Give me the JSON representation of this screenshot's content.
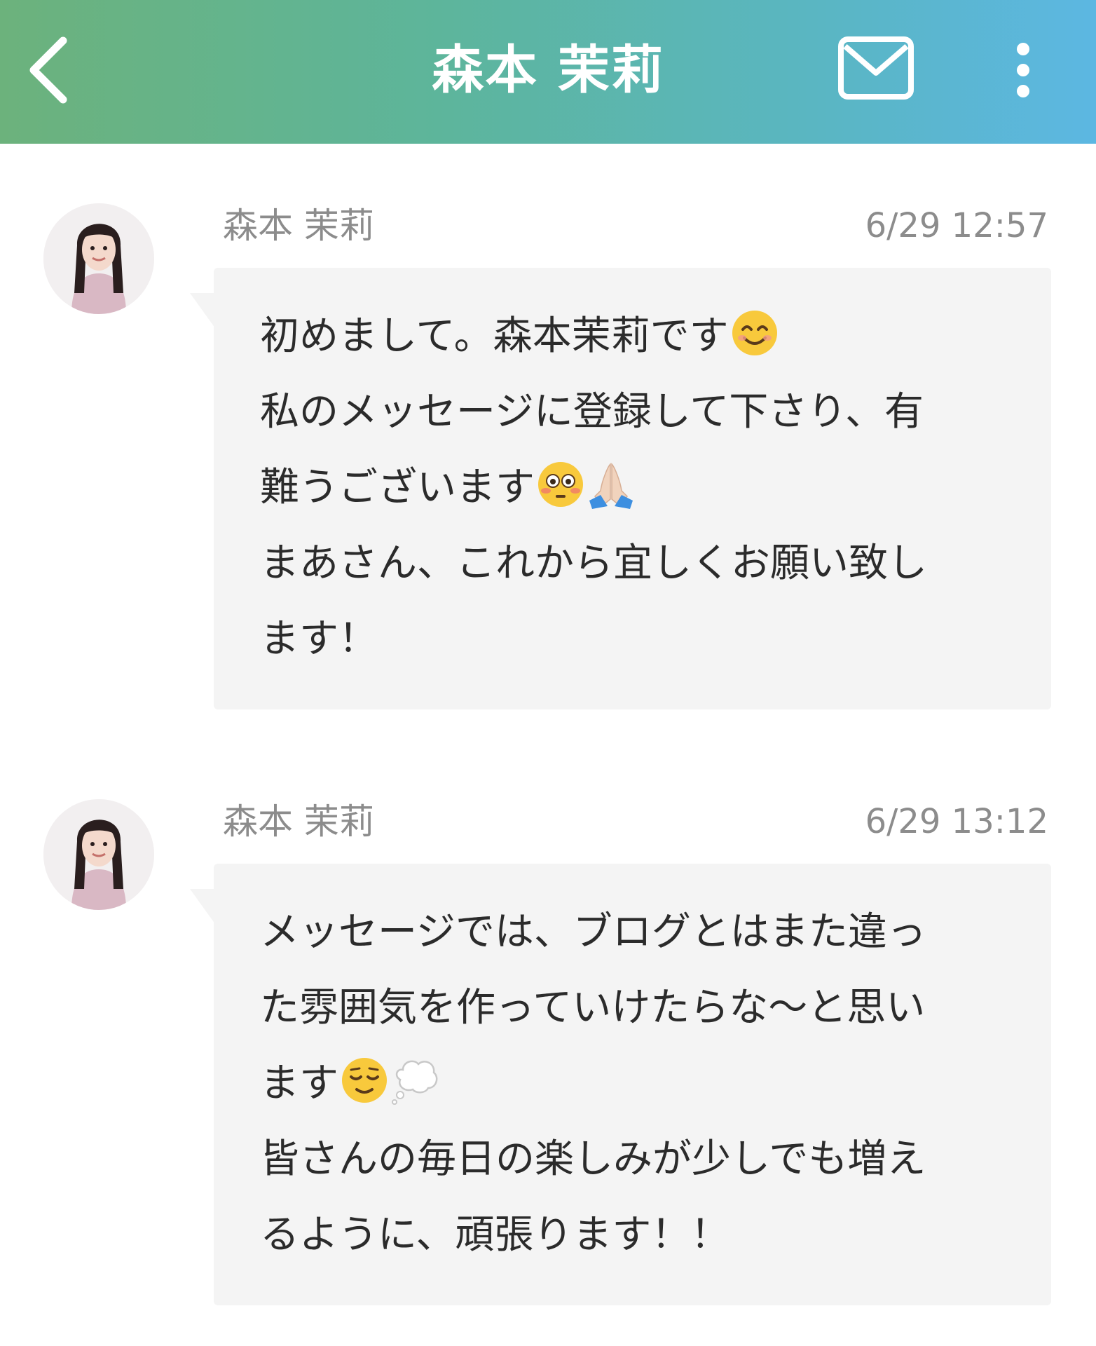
{
  "header": {
    "title": "森本 茉莉",
    "back_icon": "chevron-left-icon",
    "mail_icon": "mail-icon",
    "more_icon": "more-vertical-icon",
    "gradient": [
      "#6cb27c",
      "#5cb7e2"
    ]
  },
  "messages": [
    {
      "sender": "森本 茉莉",
      "time": "6/29 12:57",
      "lines": [
        "初めまして。森本茉莉です",
        "私のメッセージに登録して下さり、有",
        "難うございます",
        "まあさん、これから宜しくお願い致し",
        "ます！"
      ],
      "emojis": [
        "smiling-face-icon",
        "flushed-face-icon",
        "folded-hands-icon"
      ]
    },
    {
      "sender": "森本 茉莉",
      "time": "6/29 13:12",
      "lines": [
        "メッセージでは、ブログとはまた違っ",
        "た雰囲気を作っていけたらな〜と思い",
        "ます",
        "皆さんの毎日の楽しみが少しでも増え",
        "るように、頑張ります！！"
      ],
      "emojis": [
        "relieved-face-icon",
        "thought-balloon-icon"
      ]
    }
  ]
}
